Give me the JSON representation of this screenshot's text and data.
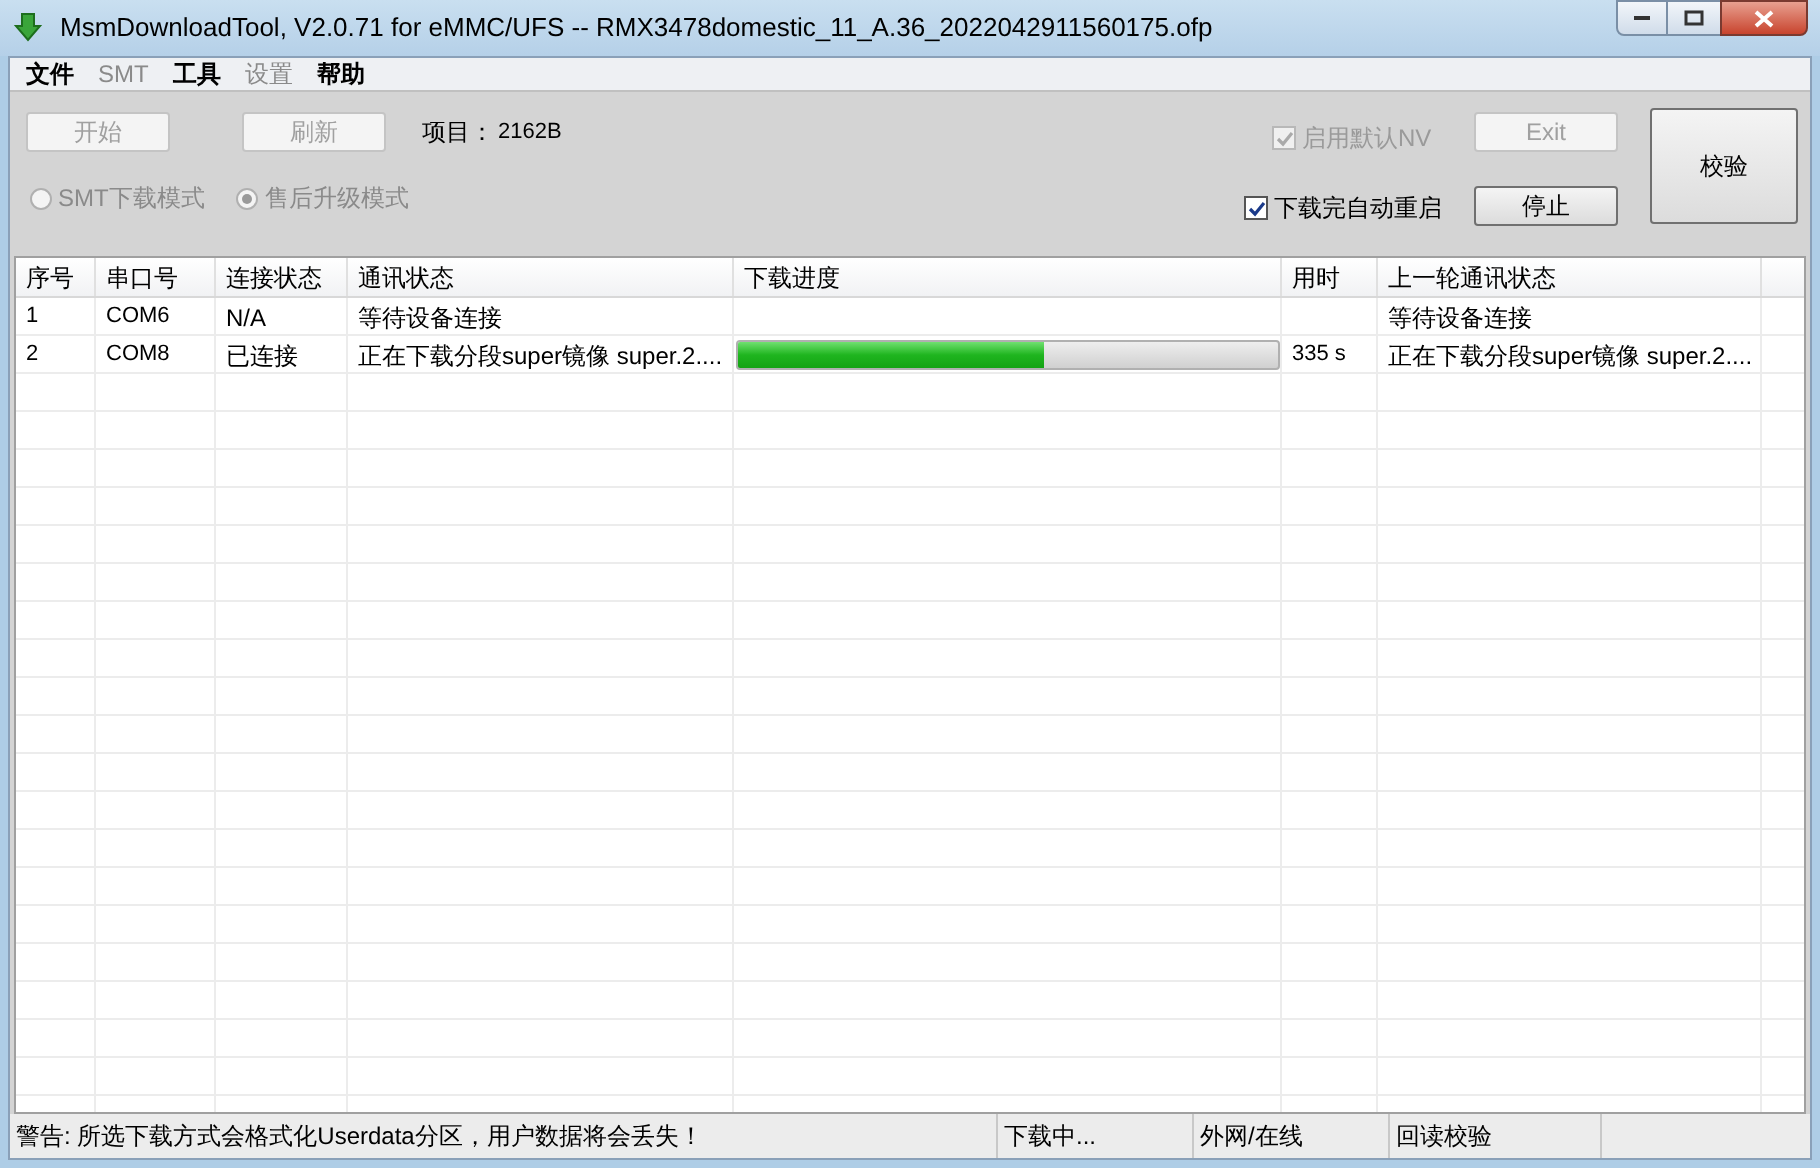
{
  "window": {
    "title": "MsmDownloadTool, V2.0.71 for eMMC/UFS -- RMX3478domestic_11_A.36_2022042911560175.ofp"
  },
  "menu": [
    {
      "label": "文件",
      "disabled": false
    },
    {
      "label": "SMT",
      "disabled": true
    },
    {
      "label": "工具",
      "disabled": false
    },
    {
      "label": "设置",
      "disabled": true
    },
    {
      "label": "帮助",
      "disabled": false
    }
  ],
  "toolbar": {
    "start_button": {
      "label": "开始",
      "disabled": true
    },
    "refresh_button": {
      "label": "刷新",
      "disabled": true
    },
    "project_label": "项目：",
    "project_value": "2162B",
    "modes": [
      {
        "label": "SMT下载模式",
        "selected": false,
        "disabled": true
      },
      {
        "label": "售后升级模式",
        "selected": true,
        "disabled": true
      }
    ],
    "checkboxes": [
      {
        "label": "启用默认NV",
        "checked": true,
        "disabled": true
      },
      {
        "label": "下载完自动重启",
        "checked": true,
        "disabled": false
      }
    ],
    "exit_button": {
      "label": "Exit",
      "disabled": true
    },
    "stop_button": {
      "label": "停止",
      "disabled": false
    },
    "verify_button": {
      "label": "校验",
      "disabled": false
    }
  },
  "table": {
    "columns": [
      "序号",
      "串口号",
      "连接状态",
      "通讯状态",
      "下载进度",
      "用时",
      "上一轮通讯状态"
    ],
    "rows": [
      {
        "index": "1",
        "port": "COM6",
        "connection": "N/A",
        "status": "等待设备连接",
        "progress": null,
        "time": "",
        "last_status": "等待设备连接"
      },
      {
        "index": "2",
        "port": "COM8",
        "connection": "已连接",
        "status": "正在下载分段super镜像 super.2....",
        "progress": {
          "level": 0.565
        },
        "time": "335 s",
        "last_status": "正在下载分段super镜像 super.2...."
      }
    ]
  },
  "status_bar": [
    "警告: 所选下载方式会格式化Userdata分区，用户数据将会丢失！",
    "下载中...",
    "外网/在线",
    "回读校验"
  ]
}
